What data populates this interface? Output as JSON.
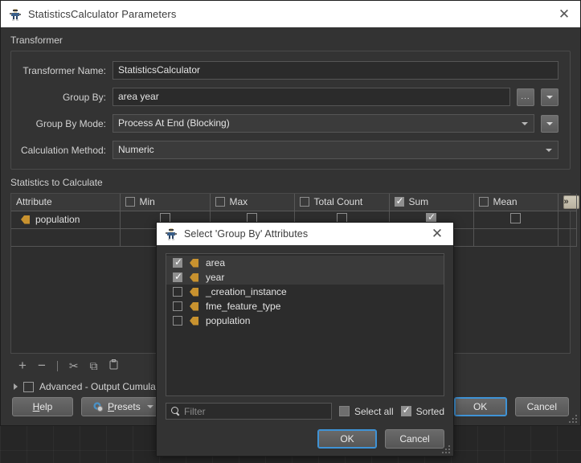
{
  "window": {
    "title": "StatisticsCalculator Parameters",
    "icon": "fme-transformer-icon",
    "close_label": "✕"
  },
  "transformer_section": {
    "label": "Transformer",
    "fields": [
      {
        "label": "Transformer Name:",
        "value": "StatisticsCalculator",
        "type": "text"
      },
      {
        "label": "Group By:",
        "value": "area year",
        "type": "text-with-buttons",
        "browse_label": "...",
        "dropdown_icon": "chevron-down-icon"
      },
      {
        "label": "Group By Mode:",
        "value": "Process At End (Blocking)",
        "type": "select",
        "dropdown_icon": "chevron-down-icon"
      },
      {
        "label": "Calculation Method:",
        "value": "Numeric",
        "type": "select"
      }
    ]
  },
  "statistics_section": {
    "label": "Statistics to Calculate",
    "columns": [
      {
        "name": "Attribute",
        "has_checkbox": false,
        "checked": false
      },
      {
        "name": "Min",
        "has_checkbox": true,
        "checked": false
      },
      {
        "name": "Max",
        "has_checkbox": true,
        "checked": false
      },
      {
        "name": "Total Count",
        "has_checkbox": true,
        "checked": false
      },
      {
        "name": "Sum",
        "has_checkbox": true,
        "checked": true
      },
      {
        "name": "Mean",
        "has_checkbox": true,
        "checked": false
      }
    ],
    "expand_button_label": "»",
    "rows": [
      {
        "attribute": "population",
        "icon": "attribute-icon",
        "cells": [
          false,
          false,
          false,
          true,
          false
        ]
      },
      {
        "attribute": "",
        "icon": "",
        "cells": [
          null,
          null,
          null,
          null,
          null
        ]
      }
    ],
    "toolbar": [
      {
        "name": "add-row-button",
        "glyph": "+"
      },
      {
        "name": "remove-row-button",
        "glyph": "−"
      },
      {
        "name": "cut-button",
        "glyph": "✂"
      },
      {
        "name": "copy-button",
        "glyph": "⧉"
      },
      {
        "name": "paste-button",
        "glyph": "📋"
      }
    ]
  },
  "advanced": {
    "label": "Advanced - Output Cumulative",
    "expanded": false,
    "checked": false
  },
  "footer": {
    "help_label": "Help",
    "help_accesskey": "H",
    "presets_label": "Presets",
    "presets_accesskey": "P",
    "ok_label": "OK",
    "cancel_label": "Cancel"
  },
  "modal": {
    "title": "Select 'Group By' Attributes",
    "icon": "fme-transformer-icon",
    "close_label": "✕",
    "attributes": [
      {
        "name": "area",
        "checked": true,
        "selected": true
      },
      {
        "name": "year",
        "checked": true,
        "selected": true
      },
      {
        "name": "_creation_instance",
        "checked": false,
        "selected": false
      },
      {
        "name": "fme_feature_type",
        "checked": false,
        "selected": false
      },
      {
        "name": "population",
        "checked": false,
        "selected": false
      }
    ],
    "filter_placeholder": "Filter",
    "filter_value": "",
    "select_all_label": "Select all",
    "select_all_checked": false,
    "sorted_label": "Sorted",
    "sorted_checked": true,
    "ok_label": "OK",
    "cancel_label": "Cancel"
  },
  "colors": {
    "dialog_bg": "#333333",
    "titlebar_bg": "#ffffff",
    "accent_blue": "#3f93d6",
    "attribute_icon": "#c8922f",
    "expand_button": "#c3bcab"
  }
}
